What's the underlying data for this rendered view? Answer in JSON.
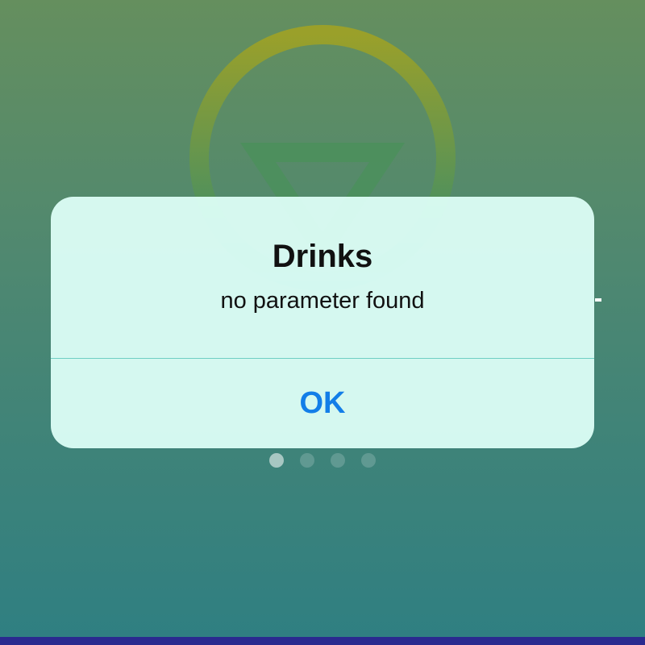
{
  "alert": {
    "title": "Drinks",
    "message": "no parameter found",
    "ok_label": "OK"
  },
  "page_indicator": {
    "count": 4,
    "active_index": 0
  },
  "icons": {
    "logo": "circle-triangle-logo-icon"
  },
  "colors": {
    "background_top": "#658f5e",
    "background_bottom": "#2f7f82",
    "alert_background": "#deffF8",
    "button_text": "#137ee8",
    "divider": "#6fcfc3",
    "bottom_bar": "#2a2a8f"
  }
}
